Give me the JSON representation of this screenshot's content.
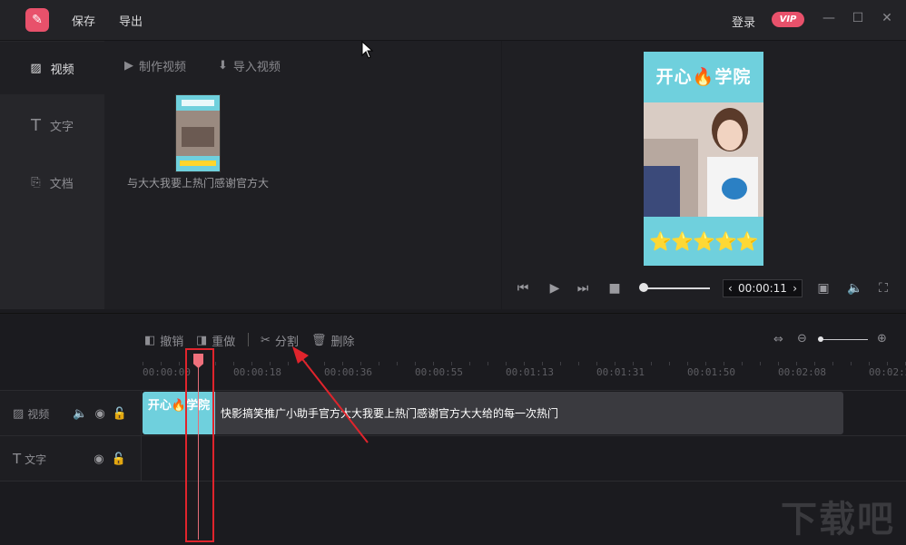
{
  "header": {
    "save_label": "保存",
    "export_label": "导出",
    "login_label": "登录",
    "vip_label": "VIP",
    "accent": "#e8516b"
  },
  "sidebar": {
    "items": [
      {
        "label": "视频"
      },
      {
        "label": "文字"
      },
      {
        "label": "文档"
      }
    ]
  },
  "media": {
    "make_video": "制作视频",
    "import_video": "导入视频",
    "clip_caption": "与大大我要上热门感谢官方大"
  },
  "preview": {
    "title": "开心🔥学院",
    "stars": "⭐⭐⭐⭐⭐",
    "timecode": "00:00:11"
  },
  "timeline": {
    "tools": {
      "undo": "撤销",
      "redo": "重做",
      "split": "分割",
      "delete": "删除"
    },
    "ruler": [
      "00:00:00",
      "00:00:18",
      "00:00:36",
      "00:00:55",
      "00:01:13",
      "00:01:31",
      "00:01:50",
      "00:02:08",
      "00:02:2"
    ],
    "tracks": {
      "video": "视频",
      "text": "文字"
    },
    "clip_title": "快影搞笑推广小助手官方大大我要上热门感谢官方大大给的每一次热门",
    "clip_thumb_text": "开心🔥学院"
  },
  "watermark": "下载吧"
}
